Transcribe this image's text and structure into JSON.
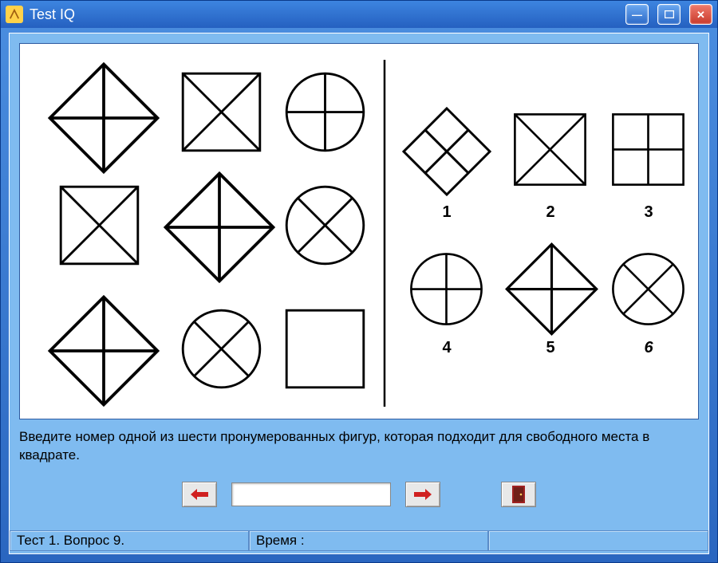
{
  "window": {
    "title": "Test IQ"
  },
  "prompt_text": "Введите номер одной из шести пронумерованных фигур, которая подходит для свободного места в квадрате.",
  "answer_value": "",
  "options": {
    "label1": "1",
    "label2": "2",
    "label3": "3",
    "label4": "4",
    "label5": "5",
    "label6": "6"
  },
  "status": {
    "left": "Тест 1. Вопрос 9.",
    "time_label": "Время :",
    "time_value": ""
  }
}
